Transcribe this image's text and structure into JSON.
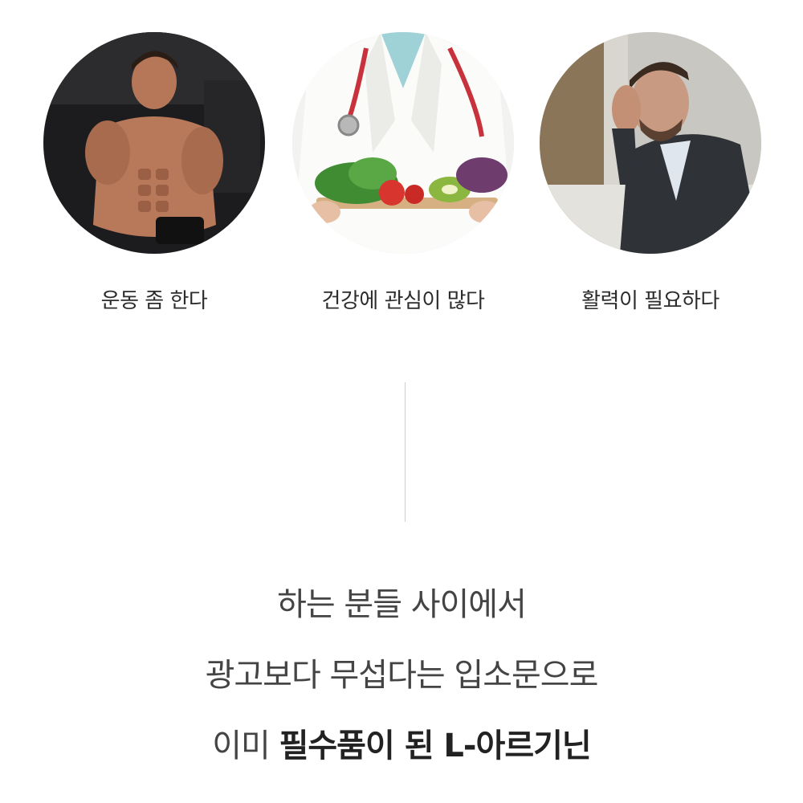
{
  "personas": [
    {
      "label": "운동 좀 한다",
      "image": "muscular-man-lifting-dumbbell"
    },
    {
      "label": "건강에 관심이 많다",
      "image": "doctor-holding-vegetable-tray"
    },
    {
      "label": "활력이 필요하다",
      "image": "tired-man-holding-head"
    }
  ],
  "message": {
    "line1": "하는 분들 사이에서",
    "line2": "광고보다 무섭다는 입소문으로",
    "line3_prefix": "이미 ",
    "line3_bold": "필수품이 된 L-아르기닌"
  }
}
